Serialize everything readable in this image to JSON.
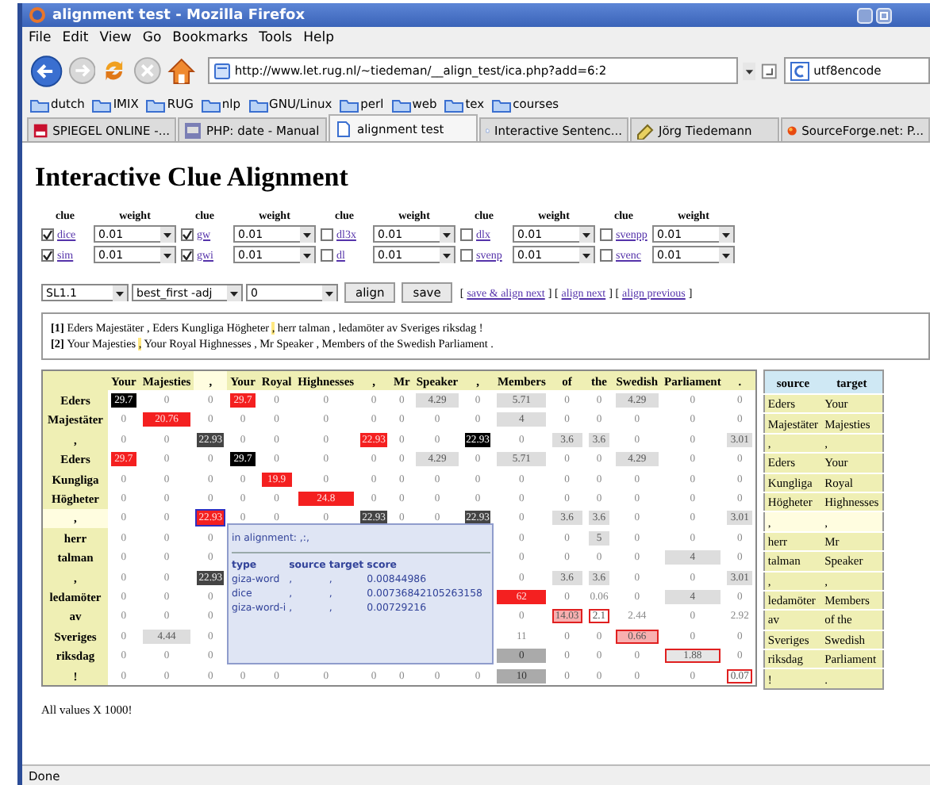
{
  "window": {
    "title": "alignment test - Mozilla Firefox"
  },
  "menu": [
    "File",
    "Edit",
    "View",
    "Go",
    "Bookmarks",
    "Tools",
    "Help"
  ],
  "toolbar": {
    "url": "http://www.let.rug.nl/~tiedeman/__align_test/ica.php?add=6:2",
    "search": "utf8encode"
  },
  "bookmarks": [
    "dutch",
    "IMIX",
    "RUG",
    "nlp",
    "GNU/Linux",
    "perl",
    "web",
    "tex",
    "courses"
  ],
  "tabs": [
    {
      "label": "SPIEGEL ONLINE -...",
      "selected": false
    },
    {
      "label": "PHP: date - Manual",
      "selected": false
    },
    {
      "label": "alignment test",
      "selected": true
    },
    {
      "label": "Interactive Sentenc...",
      "selected": false
    },
    {
      "label": "Jörg Tiedemann",
      "selected": false
    },
    {
      "label": "SourceForge.net: P...",
      "selected": false
    }
  ],
  "page": {
    "heading": "Interactive Clue Alignment",
    "clue_headers": [
      "clue",
      "weight",
      "clue",
      "weight",
      "clue",
      "weight",
      "clue",
      "weight",
      "clue",
      "weight"
    ],
    "clues": [
      [
        {
          "name": "dice",
          "checked": true,
          "weight": "0.01"
        },
        {
          "name": "gw",
          "checked": true,
          "weight": "0.01"
        },
        {
          "name": "dl3x",
          "checked": false,
          "weight": "0.01"
        },
        {
          "name": "dlx",
          "checked": false,
          "weight": "0.01"
        },
        {
          "name": "svenpp",
          "checked": false,
          "weight": "0.01"
        }
      ],
      [
        {
          "name": "sim",
          "checked": true,
          "weight": "0.01"
        },
        {
          "name": "gwi",
          "checked": true,
          "weight": "0.01"
        },
        {
          "name": "dl",
          "checked": false,
          "weight": "0.01"
        },
        {
          "name": "svenp",
          "checked": false,
          "weight": "0.01"
        },
        {
          "name": "svenc",
          "checked": false,
          "weight": "0.01"
        }
      ]
    ],
    "controls": {
      "selects": [
        "SL1.1",
        "best_first -adj",
        "0"
      ],
      "buttons": [
        "align",
        "save"
      ],
      "link_row": [
        {
          "kind": "text",
          "text": "["
        },
        {
          "kind": "link",
          "text": "save & align next"
        },
        {
          "kind": "text",
          "text": "] ["
        },
        {
          "kind": "link",
          "text": "align next"
        },
        {
          "kind": "text",
          "text": "] ["
        },
        {
          "kind": "link",
          "text": "align previous"
        },
        {
          "kind": "text",
          "text": "]"
        }
      ]
    },
    "sentences": [
      {
        "index": "[1]",
        "parts": [
          {
            "text": "Eders Majestäter , Eders Kungliga Högheter ",
            "highlight": false
          },
          {
            "text": ",",
            "highlight": true
          },
          {
            "text": " herr talman , ledamöter av Sveriges riksdag !",
            "highlight": false
          }
        ]
      },
      {
        "index": "[2]",
        "parts": [
          {
            "text": "Your Majesties ",
            "highlight": false
          },
          {
            "text": ",",
            "highlight": true
          },
          {
            "text": " Your Royal Highnesses , Mr Speaker , Members of the Swedish Parliament .",
            "highlight": false
          }
        ]
      }
    ],
    "matrix": {
      "columns": [
        {
          "label": "Your",
          "selected": false
        },
        {
          "label": "Majesties",
          "selected": false
        },
        {
          "label": ",",
          "selected": true
        },
        {
          "label": "Your",
          "selected": false
        },
        {
          "label": "Royal",
          "selected": false
        },
        {
          "label": "Highnesses",
          "selected": false
        },
        {
          "label": ",",
          "selected": false
        },
        {
          "label": "Mr",
          "selected": false
        },
        {
          "label": "Speaker",
          "selected": false
        },
        {
          "label": ",",
          "selected": false
        },
        {
          "label": "Members",
          "selected": false
        },
        {
          "label": "of",
          "selected": false
        },
        {
          "label": "the",
          "selected": false
        },
        {
          "label": "Swedish",
          "selected": false
        },
        {
          "label": "Parliament",
          "selected": false
        },
        {
          "label": ".",
          "selected": false
        }
      ],
      "rows": [
        {
          "label": "Eders",
          "selected": false,
          "cells": [
            {
              "text": "29.7",
              "kind": "black"
            },
            {
              "text": "0",
              "kind": "plain"
            },
            {
              "text": "0",
              "kind": "plain"
            },
            {
              "text": "29.7",
              "kind": "red"
            },
            {
              "text": "0",
              "kind": "plain"
            },
            {
              "text": "0",
              "kind": "plain"
            },
            {
              "text": "0",
              "kind": "plain"
            },
            {
              "text": "0",
              "kind": "plain"
            },
            {
              "text": "4.29",
              "kind": "light"
            },
            {
              "text": "0",
              "kind": "plain"
            },
            {
              "text": "5.71",
              "kind": "light"
            },
            {
              "text": "0",
              "kind": "plain"
            },
            {
              "text": "0",
              "kind": "plain"
            },
            {
              "text": "4.29",
              "kind": "light"
            },
            {
              "text": "0",
              "kind": "plain"
            },
            {
              "text": "0",
              "kind": "plain"
            }
          ]
        },
        {
          "label": "Majestäter",
          "selected": false,
          "cells": [
            {
              "text": "0",
              "kind": "plain"
            },
            {
              "text": "20.76",
              "kind": "red"
            },
            {
              "text": "0",
              "kind": "plain"
            },
            {
              "text": "0",
              "kind": "plain"
            },
            {
              "text": "0",
              "kind": "plain"
            },
            {
              "text": "0",
              "kind": "plain"
            },
            {
              "text": "0",
              "kind": "plain"
            },
            {
              "text": "0",
              "kind": "plain"
            },
            {
              "text": "0",
              "kind": "plain"
            },
            {
              "text": "0",
              "kind": "plain"
            },
            {
              "text": "4",
              "kind": "light"
            },
            {
              "text": "0",
              "kind": "plain"
            },
            {
              "text": "0",
              "kind": "plain"
            },
            {
              "text": "0",
              "kind": "plain"
            },
            {
              "text": "0",
              "kind": "plain"
            },
            {
              "text": "0",
              "kind": "plain"
            }
          ]
        },
        {
          "label": ",",
          "selected": false,
          "cells": [
            {
              "text": "0",
              "kind": "plain"
            },
            {
              "text": "0",
              "kind": "plain"
            },
            {
              "text": "22.93",
              "kind": "dark"
            },
            {
              "text": "0",
              "kind": "plain"
            },
            {
              "text": "0",
              "kind": "plain"
            },
            {
              "text": "0",
              "kind": "plain"
            },
            {
              "text": "22.93",
              "kind": "red"
            },
            {
              "text": "0",
              "kind": "plain"
            },
            {
              "text": "0",
              "kind": "plain"
            },
            {
              "text": "22.93",
              "kind": "black"
            },
            {
              "text": "0",
              "kind": "plain"
            },
            {
              "text": "3.6",
              "kind": "light"
            },
            {
              "text": "3.6",
              "kind": "light"
            },
            {
              "text": "0",
              "kind": "plain"
            },
            {
              "text": "0",
              "kind": "plain"
            },
            {
              "text": "3.01",
              "kind": "light"
            }
          ]
        },
        {
          "label": "Eders",
          "selected": false,
          "cells": [
            {
              "text": "29.7",
              "kind": "red"
            },
            {
              "text": "0",
              "kind": "plain"
            },
            {
              "text": "0",
              "kind": "plain"
            },
            {
              "text": "29.7",
              "kind": "black"
            },
            {
              "text": "0",
              "kind": "plain"
            },
            {
              "text": "0",
              "kind": "plain"
            },
            {
              "text": "0",
              "kind": "plain"
            },
            {
              "text": "0",
              "kind": "plain"
            },
            {
              "text": "4.29",
              "kind": "light"
            },
            {
              "text": "0",
              "kind": "plain"
            },
            {
              "text": "5.71",
              "kind": "light"
            },
            {
              "text": "0",
              "kind": "plain"
            },
            {
              "text": "0",
              "kind": "plain"
            },
            {
              "text": "4.29",
              "kind": "light"
            },
            {
              "text": "0",
              "kind": "plain"
            },
            {
              "text": "0",
              "kind": "plain"
            }
          ]
        },
        {
          "label": "Kungliga",
          "selected": false,
          "cells": [
            {
              "text": "0",
              "kind": "plain"
            },
            {
              "text": "0",
              "kind": "plain"
            },
            {
              "text": "0",
              "kind": "plain"
            },
            {
              "text": "0",
              "kind": "plain"
            },
            {
              "text": "19.9",
              "kind": "red"
            },
            {
              "text": "0",
              "kind": "plain"
            },
            {
              "text": "0",
              "kind": "plain"
            },
            {
              "text": "0",
              "kind": "plain"
            },
            {
              "text": "0",
              "kind": "plain"
            },
            {
              "text": "0",
              "kind": "plain"
            },
            {
              "text": "0",
              "kind": "plain"
            },
            {
              "text": "0",
              "kind": "plain"
            },
            {
              "text": "0",
              "kind": "plain"
            },
            {
              "text": "0",
              "kind": "plain"
            },
            {
              "text": "0",
              "kind": "plain"
            },
            {
              "text": "0",
              "kind": "plain"
            }
          ]
        },
        {
          "label": "Högheter",
          "selected": false,
          "cells": [
            {
              "text": "0",
              "kind": "plain"
            },
            {
              "text": "0",
              "kind": "plain"
            },
            {
              "text": "0",
              "kind": "plain"
            },
            {
              "text": "0",
              "kind": "plain"
            },
            {
              "text": "0",
              "kind": "plain"
            },
            {
              "text": "24.8",
              "kind": "red"
            },
            {
              "text": "0",
              "kind": "plain"
            },
            {
              "text": "0",
              "kind": "plain"
            },
            {
              "text": "0",
              "kind": "plain"
            },
            {
              "text": "0",
              "kind": "plain"
            },
            {
              "text": "0",
              "kind": "plain"
            },
            {
              "text": "0",
              "kind": "plain"
            },
            {
              "text": "0",
              "kind": "plain"
            },
            {
              "text": "0",
              "kind": "plain"
            },
            {
              "text": "0",
              "kind": "plain"
            },
            {
              "text": "0",
              "kind": "plain"
            }
          ]
        },
        {
          "label": ",",
          "selected": true,
          "cells": [
            {
              "text": "0",
              "kind": "plain"
            },
            {
              "text": "0",
              "kind": "plain"
            },
            {
              "text": "22.93",
              "kind": "current"
            },
            {
              "text": "0",
              "kind": "plain"
            },
            {
              "text": "0",
              "kind": "plain"
            },
            {
              "text": "0",
              "kind": "plain"
            },
            {
              "text": "22.93",
              "kind": "dark"
            },
            {
              "text": "0",
              "kind": "plain"
            },
            {
              "text": "0",
              "kind": "plain"
            },
            {
              "text": "22.93",
              "kind": "dark"
            },
            {
              "text": "0",
              "kind": "plain"
            },
            {
              "text": "3.6",
              "kind": "light"
            },
            {
              "text": "3.6",
              "kind": "light"
            },
            {
              "text": "0",
              "kind": "plain"
            },
            {
              "text": "0",
              "kind": "plain"
            },
            {
              "text": "3.01",
              "kind": "light"
            }
          ]
        },
        {
          "label": "herr",
          "selected": false,
          "cells": [
            {
              "text": "0",
              "kind": "plain"
            },
            {
              "text": "0",
              "kind": "plain"
            },
            {
              "text": "0",
              "kind": "plain"
            },
            null,
            null,
            null,
            null,
            null,
            null,
            null,
            {
              "text": "0",
              "kind": "plain"
            },
            {
              "text": "0",
              "kind": "plain"
            },
            {
              "text": "5",
              "kind": "light"
            },
            {
              "text": "0",
              "kind": "plain"
            },
            {
              "text": "0",
              "kind": "plain"
            },
            {
              "text": "0",
              "kind": "plain"
            }
          ]
        },
        {
          "label": "talman",
          "selected": false,
          "cells": [
            {
              "text": "0",
              "kind": "plain"
            },
            {
              "text": "0",
              "kind": "plain"
            },
            {
              "text": "0",
              "kind": "plain"
            },
            null,
            null,
            null,
            null,
            null,
            null,
            null,
            {
              "text": "0",
              "kind": "plain"
            },
            {
              "text": "0",
              "kind": "plain"
            },
            {
              "text": "0",
              "kind": "plain"
            },
            {
              "text": "0",
              "kind": "plain"
            },
            {
              "text": "4",
              "kind": "light"
            },
            {
              "text": "0",
              "kind": "plain"
            }
          ]
        },
        {
          "label": ",",
          "selected": false,
          "cells": [
            {
              "text": "0",
              "kind": "plain"
            },
            {
              "text": "0",
              "kind": "plain"
            },
            {
              "text": "22.93",
              "kind": "dark"
            },
            null,
            null,
            null,
            null,
            null,
            null,
            null,
            {
              "text": "0",
              "kind": "plain"
            },
            {
              "text": "3.6",
              "kind": "light"
            },
            {
              "text": "3.6",
              "kind": "light"
            },
            {
              "text": "0",
              "kind": "plain"
            },
            {
              "text": "0",
              "kind": "plain"
            },
            {
              "text": "3.01",
              "kind": "light"
            }
          ]
        },
        {
          "label": "ledamöter",
          "selected": false,
          "cells": [
            {
              "text": "0",
              "kind": "plain"
            },
            {
              "text": "0",
              "kind": "plain"
            },
            {
              "text": "0",
              "kind": "plain"
            },
            null,
            null,
            null,
            null,
            null,
            null,
            null,
            {
              "text": "62",
              "kind": "red"
            },
            {
              "text": "0",
              "kind": "plain"
            },
            {
              "text": "0.06",
              "kind": "plain"
            },
            {
              "text": "0",
              "kind": "plain"
            },
            {
              "text": "4",
              "kind": "light"
            },
            {
              "text": "0",
              "kind": "plain"
            }
          ]
        },
        {
          "label": "av",
          "selected": false,
          "cells": [
            {
              "text": "0",
              "kind": "plain"
            },
            {
              "text": "0",
              "kind": "plain"
            },
            {
              "text": "0",
              "kind": "plain"
            },
            null,
            null,
            null,
            null,
            null,
            null,
            null,
            {
              "text": "0",
              "kind": "plain"
            },
            {
              "text": "14.03",
              "kind": "boxed-pink"
            },
            {
              "text": "2.1",
              "kind": "boxed"
            },
            {
              "text": "2.44",
              "kind": "plain"
            },
            {
              "text": "0",
              "kind": "plain"
            },
            {
              "text": "2.92",
              "kind": "plain"
            }
          ]
        },
        {
          "label": "Sveriges",
          "selected": false,
          "cells": [
            {
              "text": "0",
              "kind": "plain"
            },
            {
              "text": "4.44",
              "kind": "light"
            },
            {
              "text": "0",
              "kind": "plain"
            },
            null,
            null,
            null,
            null,
            null,
            null,
            null,
            {
              "text": "11",
              "kind": "plain"
            },
            {
              "text": "0",
              "kind": "plain"
            },
            {
              "text": "0",
              "kind": "plain"
            },
            {
              "text": "0.66",
              "kind": "boxed-pink"
            },
            {
              "text": "0",
              "kind": "plain"
            },
            {
              "text": "0",
              "kind": "plain"
            }
          ]
        },
        {
          "label": "riksdag",
          "selected": false,
          "cells": [
            {
              "text": "0",
              "kind": "plain"
            },
            {
              "text": "0",
              "kind": "plain"
            },
            {
              "text": "0",
              "kind": "plain"
            },
            null,
            null,
            null,
            null,
            null,
            null,
            null,
            {
              "text": "0",
              "kind": "grey"
            },
            {
              "text": "0",
              "kind": "plain"
            },
            {
              "text": "0",
              "kind": "plain"
            },
            {
              "text": "0",
              "kind": "plain"
            },
            {
              "text": "1.88",
              "kind": "boxed-grey"
            },
            {
              "text": "0",
              "kind": "plain"
            }
          ]
        },
        {
          "label": "!",
          "selected": false,
          "cells": [
            {
              "text": "0",
              "kind": "plain"
            },
            {
              "text": "0",
              "kind": "plain"
            },
            {
              "text": "0",
              "kind": "plain"
            },
            {
              "text": "0",
              "kind": "plain"
            },
            {
              "text": "0",
              "kind": "plain"
            },
            {
              "text": "0",
              "kind": "plain"
            },
            {
              "text": "0",
              "kind": "plain"
            },
            {
              "text": "0",
              "kind": "plain"
            },
            {
              "text": "0",
              "kind": "plain"
            },
            {
              "text": "0",
              "kind": "plain"
            },
            {
              "text": "10",
              "kind": "grey"
            },
            {
              "text": "0",
              "kind": "plain"
            },
            {
              "text": "0",
              "kind": "plain"
            },
            {
              "text": "0",
              "kind": "plain"
            },
            {
              "text": "0",
              "kind": "plain"
            },
            {
              "text": "0.07",
              "kind": "boxed"
            }
          ]
        }
      ]
    },
    "tooltip": {
      "title": "in alignment: ,:,",
      "columns": [
        "type",
        "source",
        "target",
        "score"
      ],
      "rows": [
        [
          "giza-word",
          ",",
          ",",
          "0.00844986"
        ],
        [
          "dice",
          ",",
          ",",
          "0.00736842105263158"
        ],
        [
          "giza-word-i",
          ",",
          ",",
          "0.00729216"
        ]
      ]
    },
    "links_table": {
      "columns": [
        "source",
        "target"
      ],
      "rows": [
        {
          "source": "Eders",
          "target": "Your",
          "selected": false
        },
        {
          "source": "Majestäter",
          "target": "Majesties",
          "selected": false
        },
        {
          "source": ",",
          "target": ",",
          "selected": false
        },
        {
          "source": "Eders",
          "target": "Your",
          "selected": false
        },
        {
          "source": "Kungliga",
          "target": "Royal",
          "selected": false
        },
        {
          "source": "Högheter",
          "target": "Highnesses",
          "selected": false
        },
        {
          "source": ",",
          "target": ",",
          "selected": true
        },
        {
          "source": "herr",
          "target": "Mr",
          "selected": false
        },
        {
          "source": "talman",
          "target": "Speaker",
          "selected": false
        },
        {
          "source": ",",
          "target": ",",
          "selected": false
        },
        {
          "source": "ledamöter",
          "target": "Members",
          "selected": false
        },
        {
          "source": "av",
          "target": "of the",
          "selected": false
        },
        {
          "source": "Sveriges",
          "target": "Swedish",
          "selected": false
        },
        {
          "source": "riksdag",
          "target": "Parliament",
          "selected": false
        },
        {
          "source": "!",
          "target": ".",
          "selected": false
        }
      ]
    },
    "note": "All values X 1000!"
  },
  "status_bar": "Done"
}
